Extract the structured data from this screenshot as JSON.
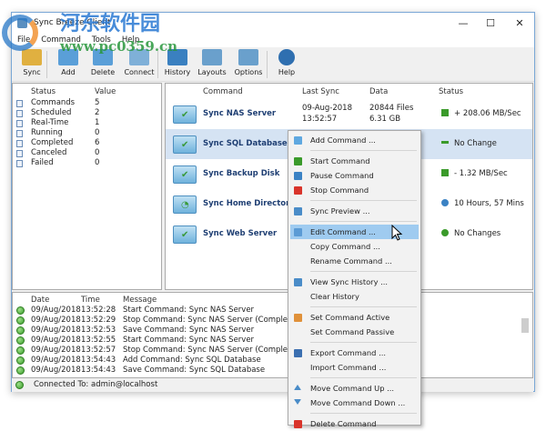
{
  "window": {
    "title": "Sync Breeze Client",
    "minimize": "—",
    "maximize": "☐",
    "close": "✕"
  },
  "watermark": {
    "text": "河东软件园",
    "url": "www.pc0359.cn"
  },
  "menubar": [
    "File",
    "Command",
    "Tools",
    "Help"
  ],
  "toolbar": [
    {
      "label": "Sync",
      "icon": "sync-icon"
    },
    {
      "label": "Add",
      "icon": "add-icon"
    },
    {
      "label": "Delete",
      "icon": "delete-icon"
    },
    {
      "label": "Connect",
      "icon": "connect-icon"
    },
    {
      "label": "History",
      "icon": "history-icon"
    },
    {
      "label": "Layouts",
      "icon": "layouts-icon"
    },
    {
      "label": "Options",
      "icon": "options-icon"
    },
    {
      "label": "Help",
      "icon": "help-icon"
    }
  ],
  "summary": {
    "headers": [
      "Status",
      "Value"
    ],
    "rows": [
      [
        "Commands",
        "5"
      ],
      [
        "Scheduled",
        "2"
      ],
      [
        "Real-Time",
        "1"
      ],
      [
        "Running",
        "0"
      ],
      [
        "Completed",
        "6"
      ],
      [
        "Canceled",
        "0"
      ],
      [
        "Failed",
        "0"
      ]
    ]
  },
  "commands": {
    "headers": [
      "Command",
      "Last Sync",
      "Data",
      "Status"
    ],
    "rows": [
      {
        "name": "Sync NAS Server",
        "last_sync_date": "09-Aug-2018",
        "last_sync_time": "13:52:57",
        "files": "20844 Files",
        "size": "6.31 GB",
        "status": "+ 208.06 MB/Sec",
        "status_icon": "arrow-up-icon"
      },
      {
        "name": "Sync SQL Database",
        "status": "No Change",
        "status_icon": "minus-icon"
      },
      {
        "name": "Sync Backup Disk",
        "status": "- 1.32 MB/Sec",
        "status_icon": "arrow-down-icon"
      },
      {
        "name": "Sync Home Directories",
        "status": "10 Hours, 57 Mins",
        "status_icon": "clock-icon"
      },
      {
        "name": "Sync Web Server",
        "status": "No Changes",
        "status_icon": "green-dot-icon"
      }
    ]
  },
  "context_menu": [
    {
      "label": "Add Command ...",
      "icon": "plus-icon",
      "color": "#5fa8e0"
    },
    "sep",
    {
      "label": "Start Command",
      "icon": "play-icon",
      "color": "#3a9a2a"
    },
    {
      "label": "Pause Command",
      "icon": "pause-icon",
      "color": "#3b82c4"
    },
    {
      "label": "Stop Command",
      "icon": "stop-icon",
      "color": "#d9342b"
    },
    "sep",
    {
      "label": "Sync Preview ...",
      "icon": "preview-icon",
      "color": "#4a8cc8"
    },
    "sep",
    {
      "label": "Edit Command ...",
      "icon": "edit-icon",
      "color": "#5b9bd5",
      "highlighted": true
    },
    {
      "label": "Copy Command ..."
    },
    {
      "label": "Rename Command ..."
    },
    "sep",
    {
      "label": "View Sync History ...",
      "icon": "chart-icon",
      "color": "#4a8cc8"
    },
    {
      "label": "Clear History"
    },
    "sep",
    {
      "label": "Set Command Active",
      "icon": "active-icon",
      "color": "#e0913a"
    },
    {
      "label": "Set Command Passive"
    },
    "sep",
    {
      "label": "Export Command ...",
      "icon": "save-icon",
      "color": "#3b6fb0"
    },
    {
      "label": "Import Command ..."
    },
    "sep",
    {
      "label": "Move Command Up ...",
      "icon": "triangle-up-icon",
      "color": "#4a8cc8"
    },
    {
      "label": "Move Command Down ...",
      "icon": "triangle-down-icon",
      "color": "#4a8cc8"
    },
    "sep",
    {
      "label": "Delete Command",
      "icon": "delete-x-icon",
      "color": "#d9342b"
    }
  ],
  "log": {
    "headers": [
      "Date",
      "Time",
      "Message"
    ],
    "rows": [
      [
        "09/Aug/2018",
        "13:52:28",
        "Start Command: Sync NAS Server"
      ],
      [
        "09/Aug/2018",
        "13:52:29",
        "Stop Command: Sync NAS Server (Completed)"
      ],
      [
        "09/Aug/2018",
        "13:52:53",
        "Save Command: Sync NAS Server"
      ],
      [
        "09/Aug/2018",
        "13:52:55",
        "Start Command: Sync NAS Server"
      ],
      [
        "09/Aug/2018",
        "13:52:57",
        "Stop Command: Sync NAS Server (Completed)"
      ],
      [
        "09/Aug/2018",
        "13:54:43",
        "Add Command: Sync SQL Database"
      ],
      [
        "09/Aug/2018",
        "13:54:43",
        "Save Command: Sync SQL Database"
      ]
    ]
  },
  "statusbar": {
    "text": "Connected To: admin@localhost"
  }
}
